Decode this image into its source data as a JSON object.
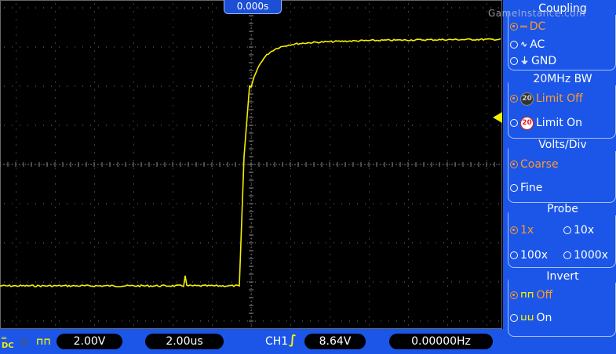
{
  "screen": {
    "time_offset": "0.000s"
  },
  "watermark": "GameInstance.com",
  "menu": {
    "coupling": {
      "title": "Coupling",
      "options": [
        {
          "label": "DC",
          "icon": "dc-coupling-icon",
          "selected": true
        },
        {
          "label": "AC",
          "icon": "ac-coupling-icon",
          "selected": false
        },
        {
          "label": "GND",
          "icon": "ground-icon",
          "selected": false
        }
      ]
    },
    "bw_limit": {
      "title": "20MHz BW",
      "options": [
        {
          "label": "Limit Off",
          "icon_text": "20",
          "selected": true
        },
        {
          "label": "Limit On",
          "icon_text": "20",
          "selected": false
        }
      ]
    },
    "volts_div": {
      "title": "Volts/Div",
      "options": [
        {
          "label": "Coarse",
          "selected": true
        },
        {
          "label": "Fine",
          "selected": false
        }
      ]
    },
    "probe": {
      "title": "Probe",
      "options": [
        {
          "label": "1x",
          "selected": true
        },
        {
          "label": "10x",
          "selected": false
        },
        {
          "label": "100x",
          "selected": false
        },
        {
          "label": "1000x",
          "selected": false
        }
      ]
    },
    "invert": {
      "title": "Invert",
      "options": [
        {
          "label": "Off",
          "selected": true
        },
        {
          "label": "On",
          "selected": false
        }
      ]
    }
  },
  "status_bar": {
    "coupling_icon": "DC",
    "volts_per_div": "2.00V",
    "time_per_div": "2.00us",
    "trigger_source": "CH1",
    "trigger_level": "8.64V",
    "frequency": "0.00000Hz"
  },
  "colors": {
    "trace": "#f3f000",
    "menu_bg": "#1b56e8",
    "selected": "#ff9a2a"
  }
}
